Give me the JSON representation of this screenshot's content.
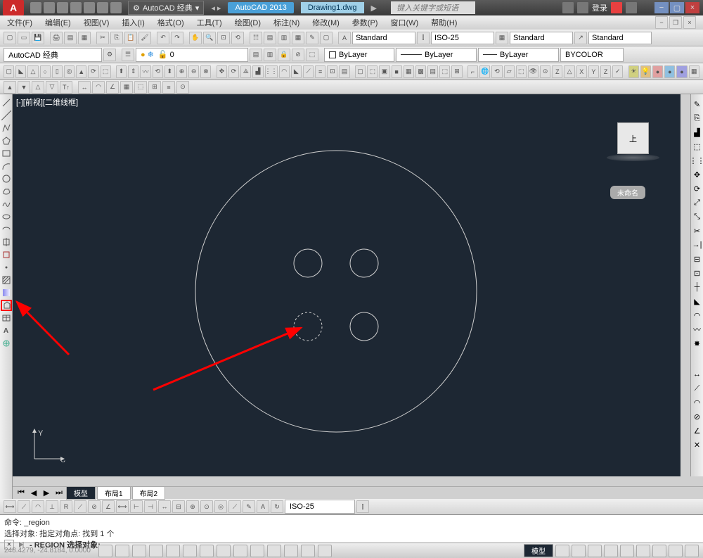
{
  "title": {
    "app": "AutoCAD 2013",
    "file": "Drawing1.dwg",
    "workspace_selector": "AutoCAD 经典",
    "search_placeholder": "键入关键字或短语",
    "login": "登录"
  },
  "menu": {
    "file": "文件(F)",
    "edit": "编辑(E)",
    "view": "视图(V)",
    "insert": "插入(I)",
    "format": "格式(O)",
    "tools": "工具(T)",
    "draw": "绘图(D)",
    "dimension": "标注(N)",
    "modify": "修改(M)",
    "param": "参数(P)",
    "window": "窗口(W)",
    "help": "帮助(H)"
  },
  "standard_toolbar": {
    "style1": "Standard",
    "style2": "ISO-25",
    "style3": "Standard",
    "style4": "Standard"
  },
  "layers": {
    "workspace": "AutoCAD 经典",
    "layer_state": "0",
    "color": "ByLayer",
    "linetype": "ByLayer",
    "lineweight": "ByLayer",
    "plotstyle": "BYCOLOR"
  },
  "viewport": {
    "label": "[-][前视][二维线框]",
    "viewcube": "上",
    "unsaved": "未命名"
  },
  "tabs": {
    "model": "模型",
    "layout1": "布局1",
    "layout2": "布局2"
  },
  "dim_style": "ISO-25",
  "command": {
    "line1": "命令: _region",
    "line2": "选择对象: 指定对角点: 找到 1 个",
    "prompt": "- REGION 选择对象:"
  },
  "status": {
    "coords": "248.4279, -24.8184, 0.0000",
    "ms": "模型"
  }
}
